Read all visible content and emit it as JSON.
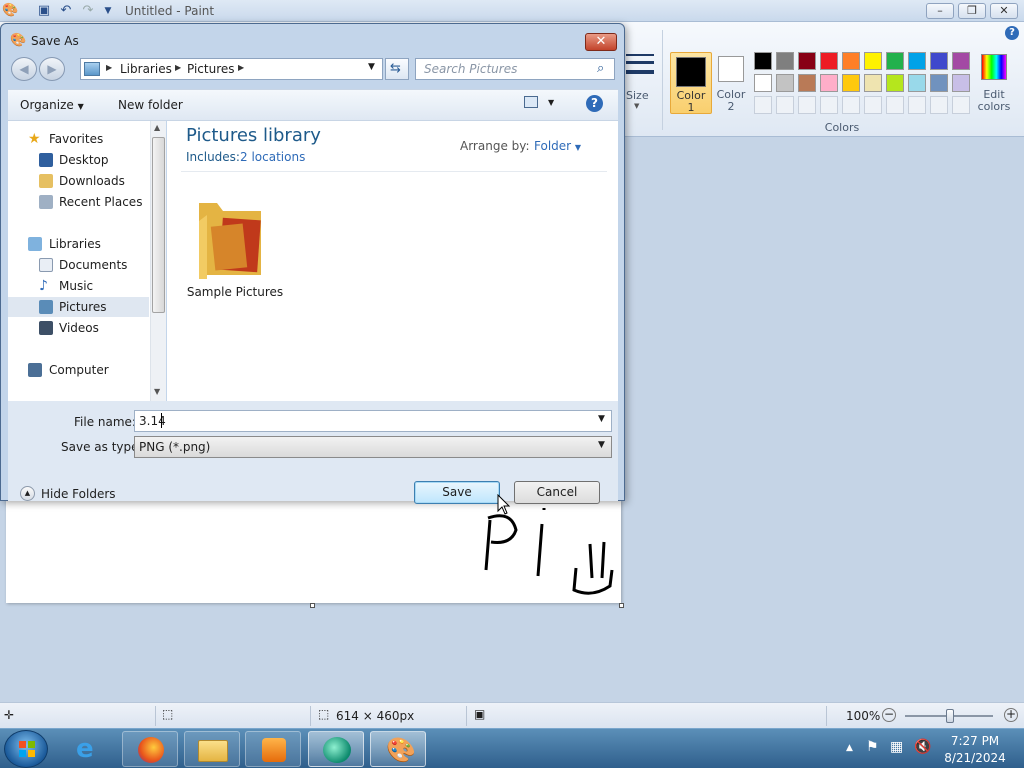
{
  "paint": {
    "title": "Untitled - Paint",
    "ribbon": {
      "size_label": "Size",
      "color1_label_a": "Color",
      "color1_label_b": "1",
      "color2_label_a": "Color",
      "color2_label_b": "2",
      "edit_colors_a": "Edit",
      "edit_colors_b": "colors",
      "colors_group_label": "Colors",
      "palette_row1": [
        "#000000",
        "#7f7f7f",
        "#880015",
        "#ed1c24",
        "#ff7f27",
        "#fff200",
        "#22b14c",
        "#00a2e8",
        "#3f48cc",
        "#a349a4"
      ],
      "palette_row2": [
        "#ffffff",
        "#c3c3c3",
        "#b97a57",
        "#ffaec9",
        "#ffc90e",
        "#efe4b0",
        "#b5e61d",
        "#99d9ea",
        "#7092be",
        "#c8bfe7"
      ]
    },
    "status": {
      "canvas_size": "614 × 460px",
      "zoom": "100%"
    }
  },
  "dialog": {
    "title": "Save As",
    "breadcrumb": [
      "Libraries",
      "Pictures"
    ],
    "search_placeholder": "Search Pictures",
    "toolbar": {
      "organize": "Organize",
      "new_folder": "New folder"
    },
    "nav": {
      "favorites": "Favorites",
      "desktop": "Desktop",
      "downloads": "Downloads",
      "recent_places": "Recent Places",
      "libraries": "Libraries",
      "documents": "Documents",
      "music": "Music",
      "pictures": "Pictures",
      "videos": "Videos",
      "computer": "Computer"
    },
    "library": {
      "title": "Pictures library",
      "includes_label": "Includes:",
      "includes_value": "2 locations",
      "arrange_by_label": "Arrange by:",
      "arrange_by_value": "Folder"
    },
    "items": [
      {
        "name": "Sample Pictures"
      }
    ],
    "file_name_label": "File name:",
    "file_name_value": "3.14",
    "save_as_type_label": "Save as type:",
    "save_as_type_value": "PNG (*.png)",
    "hide_folders": "Hide Folders",
    "save_button": "Save",
    "cancel_button": "Cancel"
  },
  "taskbar": {
    "time": "7:27 PM",
    "date": "8/21/2024"
  }
}
